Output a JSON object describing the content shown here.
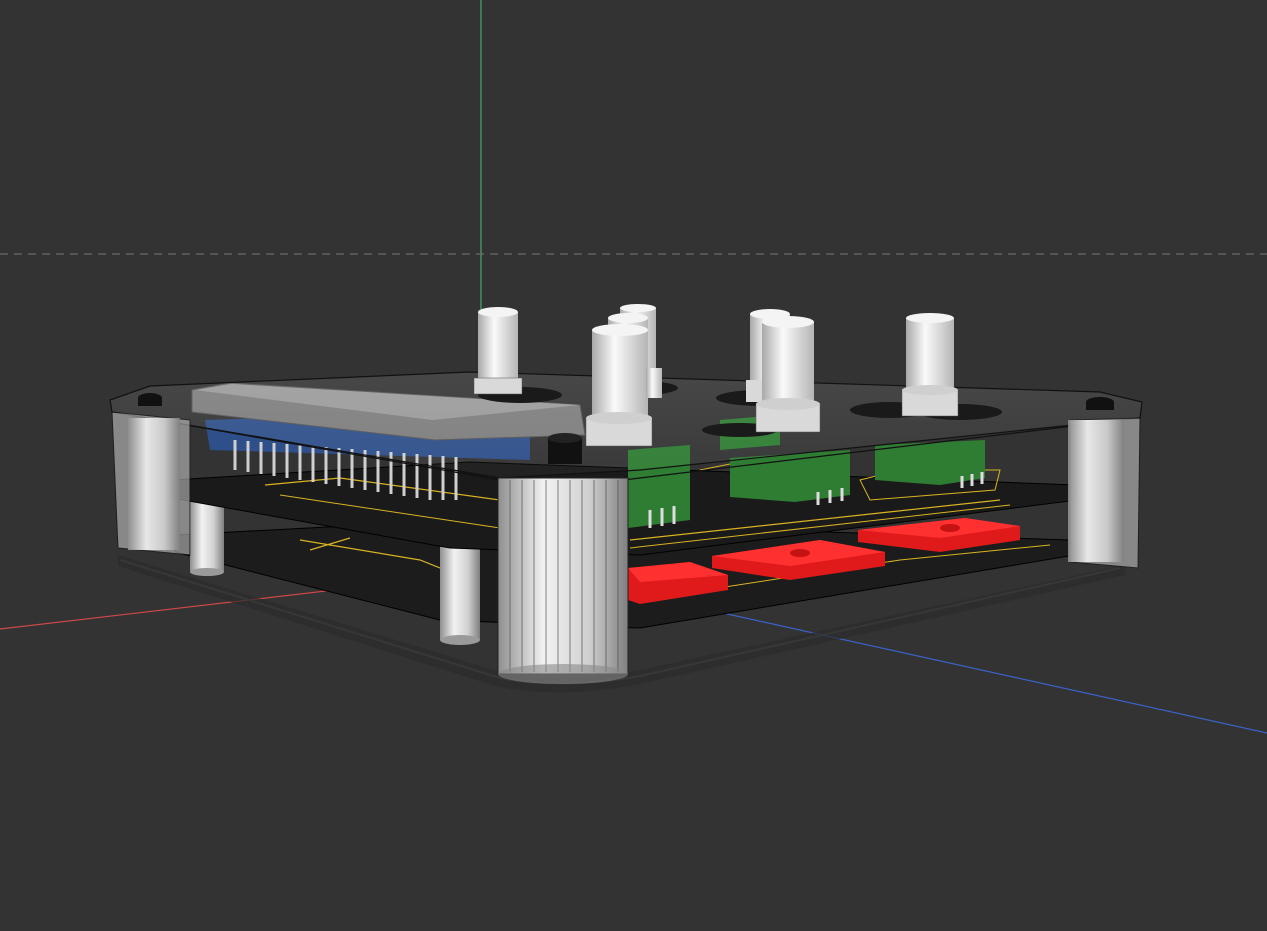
{
  "viewport": {
    "background": "#333333",
    "view": "perspective"
  },
  "axes": {
    "x_axis_color": "#d04848",
    "y_axis_color": "#4aa86a",
    "z_axis_color": "#3a62c8",
    "construction_line": "dashed"
  },
  "model": {
    "enclosure": "transparent-case",
    "top_cover": "translucent",
    "knob_count": 8,
    "button_count": 4,
    "pcb_count": 2,
    "display_module": "lcd",
    "colors": {
      "pcb": "#1c1c1c",
      "trace": "#d9b322",
      "potentiometer_body": "#2e7d32",
      "knob": "#e6e6e6",
      "button": "#e01a1a",
      "lcd_frame": "#8a8a8a",
      "lcd_board": "#2e4f8a",
      "standoff": "#c9c9c9"
    }
  }
}
